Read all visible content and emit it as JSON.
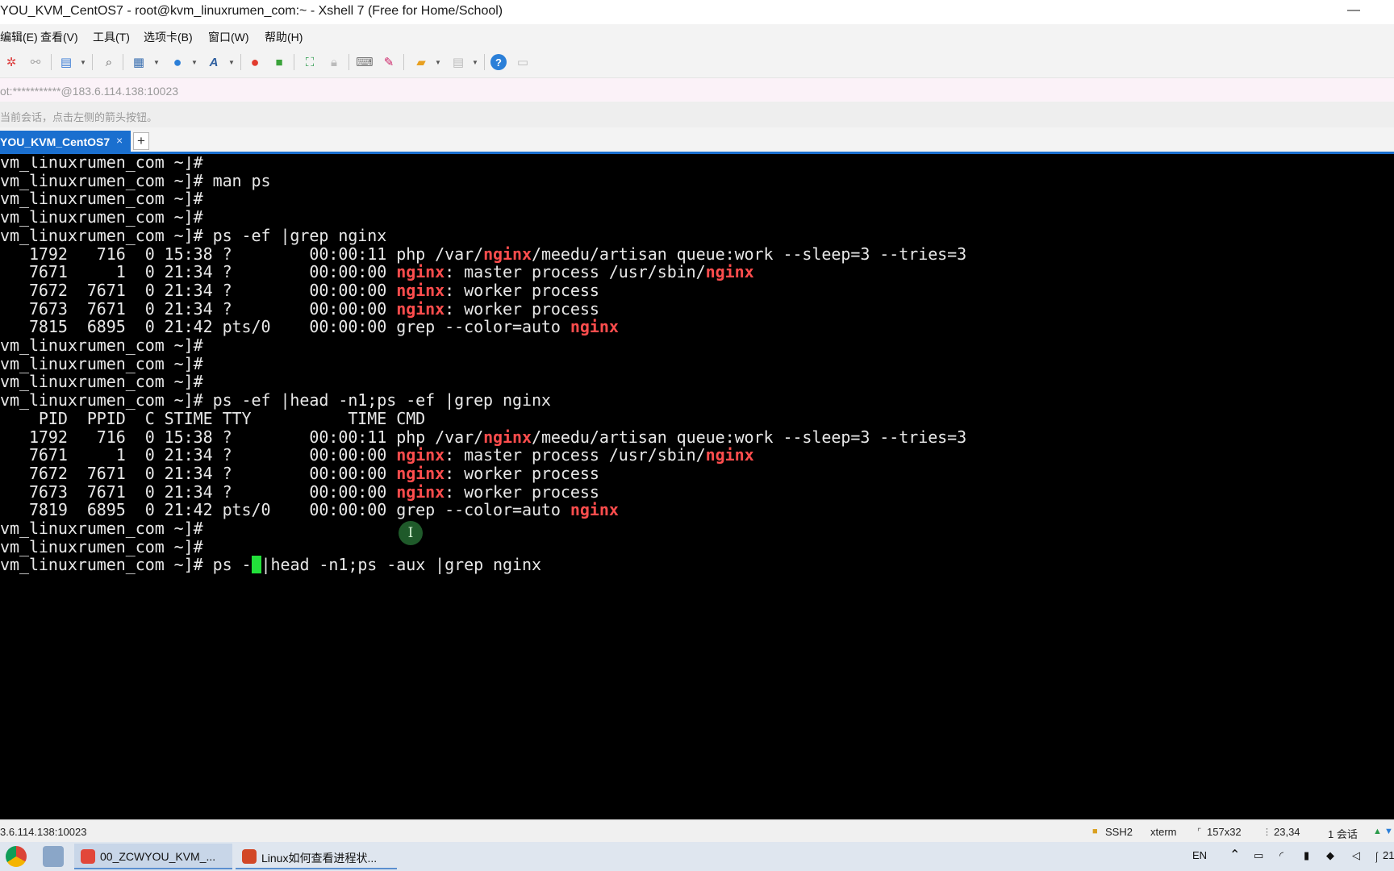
{
  "window": {
    "title": "YOU_KVM_CentOS7 - root@kvm_linuxrumen_com:~ - Xshell 7 (Free for Home/School)",
    "minimize_glyph": "—"
  },
  "menu": {
    "items": [
      "编辑(E)",
      "查看(V)",
      "工具(T)",
      "选项卡(B)",
      "窗口(W)",
      "帮助(H)"
    ]
  },
  "toolbar": {
    "icons": [
      "reconnect-icon",
      "disconnect-icon",
      "new-session-icon",
      "search-icon",
      "layout-icon",
      "globe-icon",
      "font-icon",
      "xftp-icon",
      "xftp-green-icon",
      "fullscreen-icon",
      "lock-icon",
      "keyboard-icon",
      "highlight-icon",
      "folder-icon",
      "panel-icon",
      "help-icon",
      "chat-icon"
    ]
  },
  "address": {
    "text": "ot:***********@183.6.114.138:10023"
  },
  "info": {
    "text": "当前会话，点击左侧的箭头按钮。"
  },
  "tabs": {
    "active_label": "YOU_KVM_CentOS7",
    "close_glyph": "×",
    "add_glyph": "+"
  },
  "terminal": {
    "highlight_color": "#ff4d4d",
    "cursor_color": "#22e03a",
    "lines": [
      [
        "vm_linuxrumen_com ~]#"
      ],
      [
        "vm_linuxrumen_com ~]# man ps"
      ],
      [
        "vm_linuxrumen_com ~]#"
      ],
      [
        "vm_linuxrumen_com ~]#"
      ],
      [
        "vm_linuxrumen_com ~]# ps -ef |grep nginx"
      ],
      [
        "   1792   716  0 15:38 ?        00:00:11 php /var/",
        "nginx",
        "/meedu/artisan queue:work --sleep=3 --tries=3"
      ],
      [
        "   7671     1  0 21:34 ?        00:00:00 ",
        "nginx",
        ": master process /usr/sbin/",
        "nginx"
      ],
      [
        "   7672  7671  0 21:34 ?        00:00:00 ",
        "nginx",
        ": worker process"
      ],
      [
        "   7673  7671  0 21:34 ?        00:00:00 ",
        "nginx",
        ": worker process"
      ],
      [
        "   7815  6895  0 21:42 pts/0    00:00:00 grep --color=auto ",
        "nginx"
      ],
      [
        "vm_linuxrumen_com ~]#"
      ],
      [
        "vm_linuxrumen_com ~]#"
      ],
      [
        "vm_linuxrumen_com ~]#"
      ],
      [
        "vm_linuxrumen_com ~]# ps -ef |head -n1;ps -ef |grep nginx"
      ],
      [
        "    PID  PPID  C STIME TTY          TIME CMD"
      ],
      [
        "   1792   716  0 15:38 ?        00:00:11 php /var/",
        "nginx",
        "/meedu/artisan queue:work --sleep=3 --tries=3"
      ],
      [
        "   7671     1  0 21:34 ?        00:00:00 ",
        "nginx",
        ": master process /usr/sbin/",
        "nginx"
      ],
      [
        "   7672  7671  0 21:34 ?        00:00:00 ",
        "nginx",
        ": worker process"
      ],
      [
        "   7673  7671  0 21:34 ?        00:00:00 ",
        "nginx",
        ": worker process"
      ],
      [
        "   7819  6895  0 21:42 pts/0    00:00:00 grep --color=auto ",
        "nginx"
      ],
      [
        "vm_linuxrumen_com ~]#"
      ],
      [
        "vm_linuxrumen_com ~]#"
      ]
    ],
    "input_prefix": "vm_linuxrumen_com ~]# ps -",
    "input_suffix": "|head -n1;ps -aux |grep nginx",
    "mouse_glyph": "I"
  },
  "status": {
    "address": "3.6.114.138:10023",
    "protocol": "SSH2",
    "term_type": "xterm",
    "size": "157x32",
    "cursor_pos": "23,34",
    "sessions": "1 会话"
  },
  "taskbar": {
    "task1_label": "00_ZCWYOU_KVM_...",
    "task2_label": "Linux如何查看进程状...",
    "lang": "EN",
    "clock": "21"
  }
}
